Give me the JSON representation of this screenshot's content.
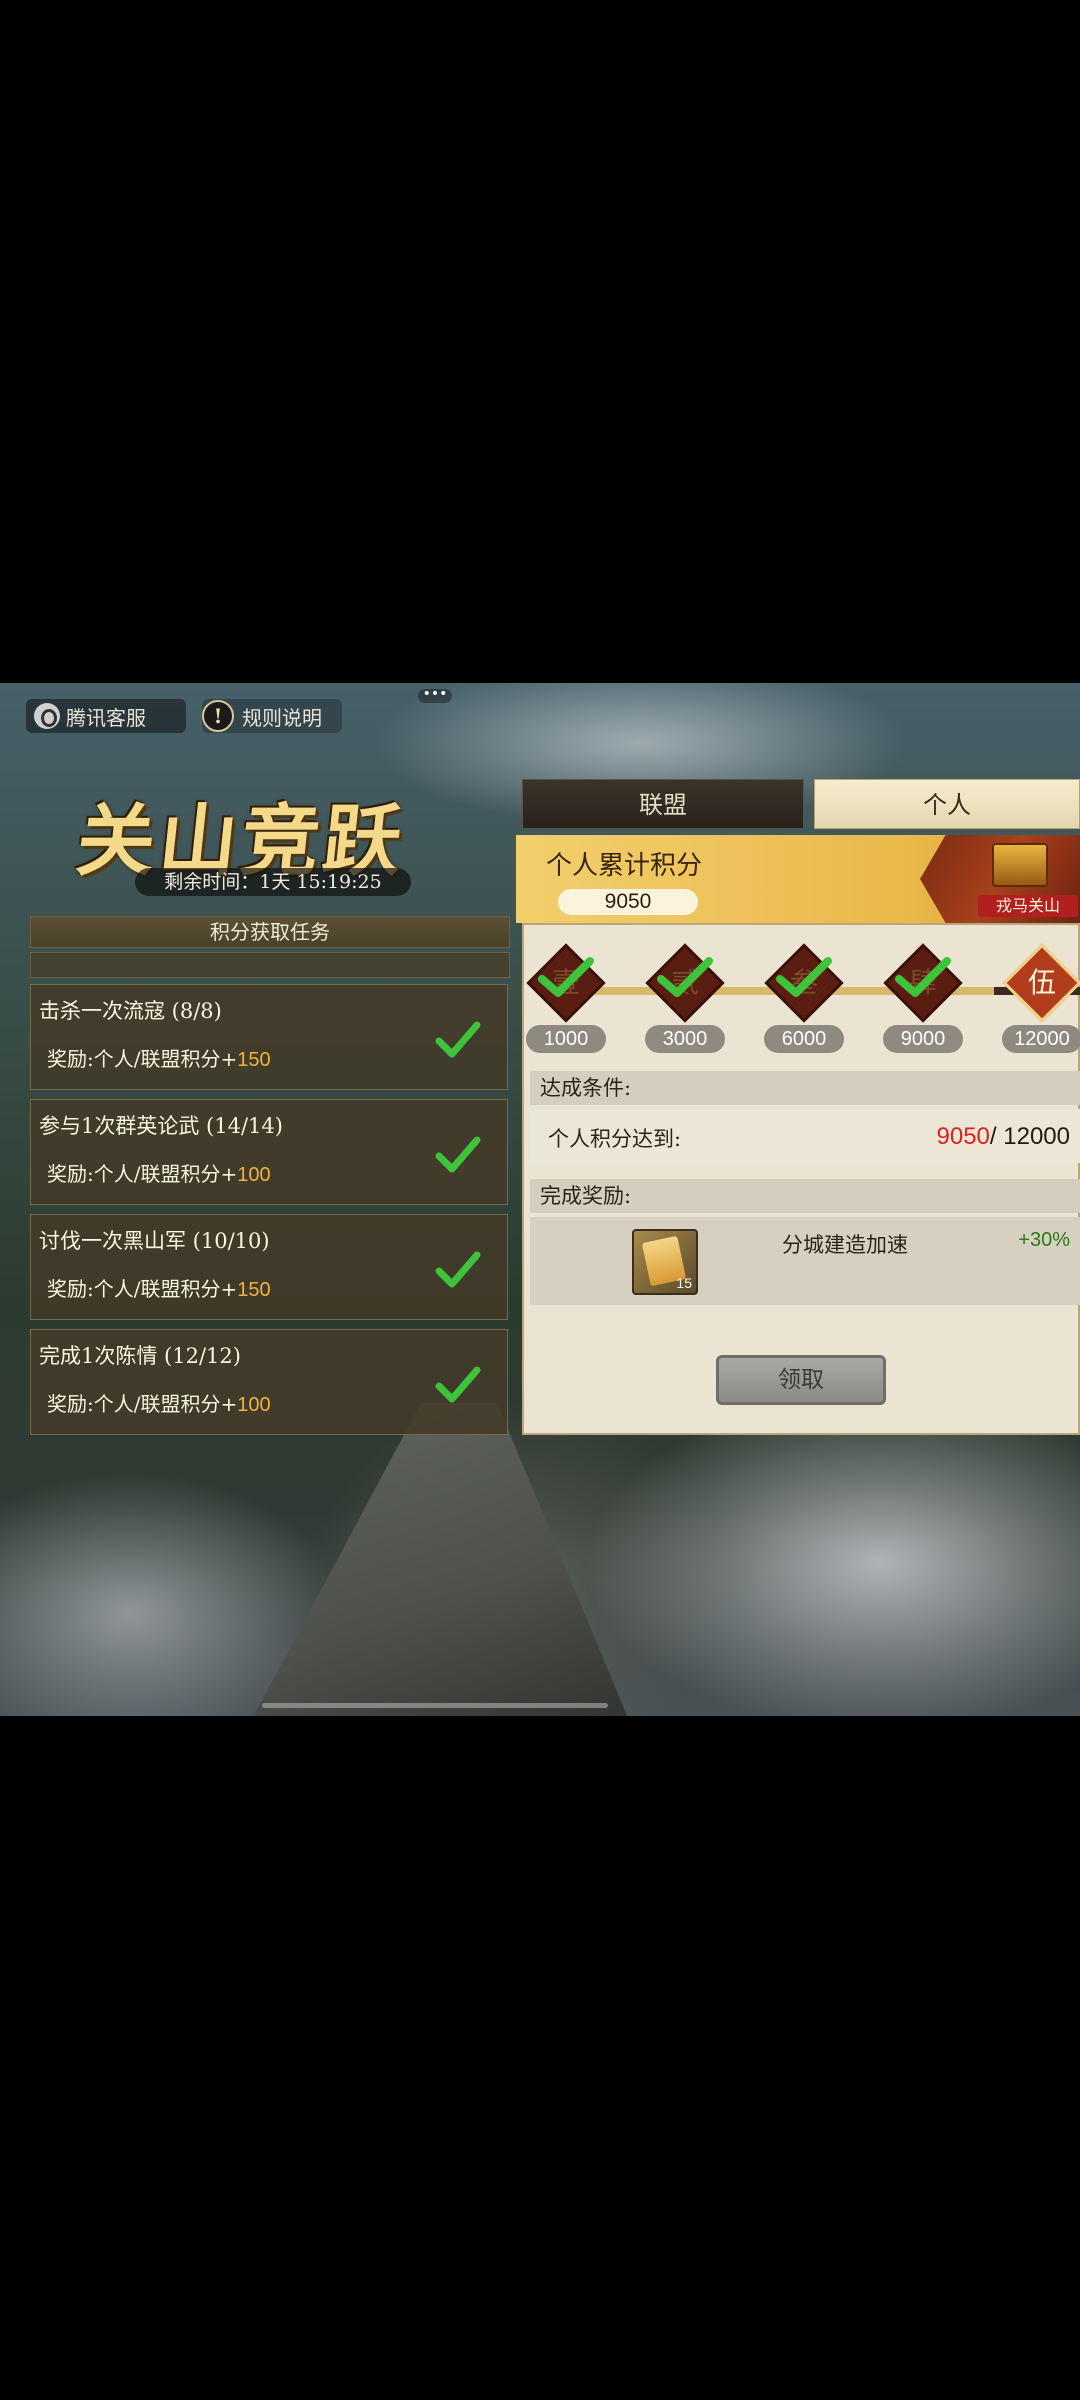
{
  "header": {
    "support_label": "腾讯客服",
    "rules_label": "规则说明",
    "rules_icon": "!",
    "more_icon": "•••"
  },
  "event": {
    "title": "关山竞跃",
    "remaining_time": "剩余时间：1天 15:19:25"
  },
  "tasks": {
    "header": "积分获取任务",
    "items": [
      {
        "title": "击杀一次流寇 (8/8)",
        "reward_prefix": "奖励:个人/联盟积分+",
        "points": "150",
        "done": true
      },
      {
        "title": "参与1次群英论武 (14/14)",
        "reward_prefix": "奖励:个人/联盟积分+",
        "points": "100",
        "done": true
      },
      {
        "title": "讨伐一次黑山军 (10/10)",
        "reward_prefix": "奖励:个人/联盟积分+",
        "points": "150",
        "done": true
      },
      {
        "title": "完成1次陈情 (12/12)",
        "reward_prefix": "奖励:个人/联盟积分+",
        "points": "100",
        "done": true
      }
    ]
  },
  "tabs": {
    "alliance": "联盟",
    "personal": "个人",
    "selected": "personal"
  },
  "score": {
    "label": "个人累计积分",
    "value": "9050",
    "chest_label": "戎马关山"
  },
  "milestones": [
    {
      "char": "壹",
      "threshold": "1000",
      "completed": true
    },
    {
      "char": "贰",
      "threshold": "3000",
      "completed": true
    },
    {
      "char": "叁",
      "threshold": "6000",
      "completed": true
    },
    {
      "char": "肆",
      "threshold": "9000",
      "completed": true
    },
    {
      "char": "伍",
      "threshold": "12000",
      "completed": false
    }
  ],
  "condition": {
    "header": "达成条件:",
    "text": "个人积分达到:",
    "current": "9050",
    "separator": "/ ",
    "target": "12000"
  },
  "reward": {
    "header": "完成奖励:",
    "item_name": "分城建造加速",
    "item_count": "15",
    "bonus": "+30%"
  },
  "claim_button": "领取",
  "colors": {
    "points": "#f2b23a",
    "current_score": "#e0211b",
    "bonus": "#2b7a1c",
    "check": "#3ec43a"
  }
}
